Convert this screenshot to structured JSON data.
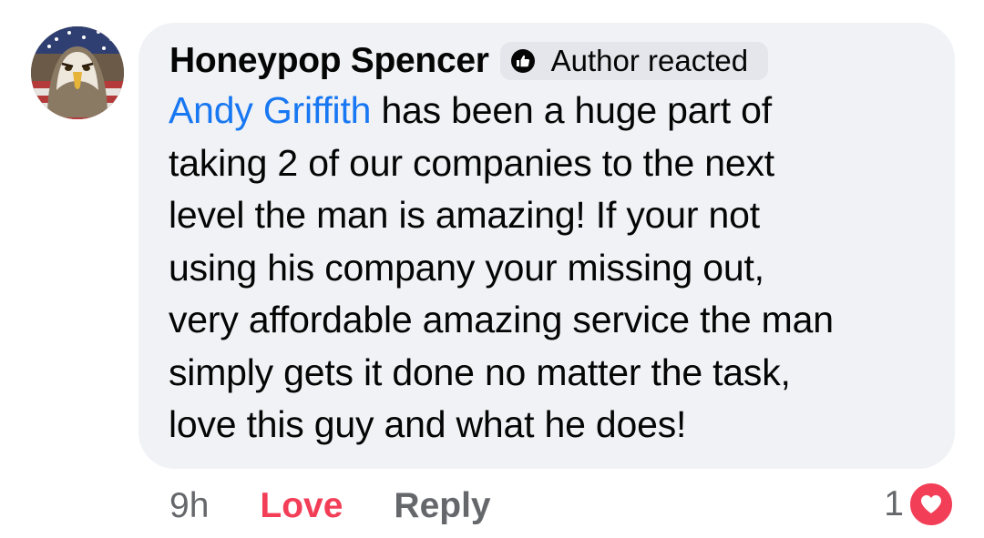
{
  "comment": {
    "author": "Honeypop Spencer",
    "badge": {
      "icon": "thumbs-up-icon",
      "label": "Author reacted"
    },
    "mention": "Andy Griffith",
    "body_lines": [
      " has been a huge part of",
      "taking 2 of our companies to the next",
      "level the man is amazing! If your not",
      "using his company your missing out,",
      "very affordable amazing service the man",
      "simply gets it done no matter the task,",
      "love this guy and what he does!"
    ]
  },
  "actions": {
    "time": "9h",
    "love": "Love",
    "reply": "Reply"
  },
  "reactions": {
    "count": "1",
    "icon": "heart-icon"
  },
  "colors": {
    "bubble": "#f0f2f5",
    "mention": "#1877f2",
    "love": "#f33e58",
    "muted": "#65676b"
  }
}
